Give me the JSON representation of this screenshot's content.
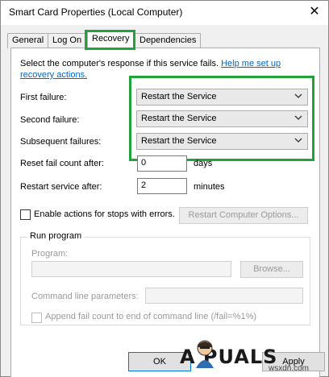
{
  "window": {
    "title": "Smart Card Properties (Local Computer)",
    "close_glyph": "✕"
  },
  "tabs": [
    {
      "label": "General"
    },
    {
      "label": "Log On"
    },
    {
      "label": "Recovery"
    },
    {
      "label": "Dependencies"
    }
  ],
  "recovery": {
    "description": "Select the computer's response if this service fails.",
    "help_link": "Help me set up recovery actions.",
    "first_failure": {
      "label": "First failure:",
      "value": "Restart the Service"
    },
    "second_failure": {
      "label": "Second failure:",
      "value": "Restart the Service"
    },
    "subsequent_failures": {
      "label": "Subsequent failures:",
      "value": "Restart the Service"
    },
    "reset_fail_count": {
      "label": "Reset fail count after:",
      "value": "0",
      "unit": "days"
    },
    "restart_service": {
      "label": "Restart service after:",
      "value": "2",
      "unit": "minutes"
    },
    "enable_actions": {
      "label": "Enable actions for stops with errors.",
      "checked": false
    },
    "restart_computer_options": "Restart Computer Options...",
    "run_program": {
      "legend": "Run program",
      "program_label": "Program:",
      "program_value": "",
      "browse_label": "Browse...",
      "cmd_label": "Command line parameters:",
      "cmd_value": "",
      "append_label": "Append fail count to end of command line (/fail=%1%)"
    }
  },
  "buttons": {
    "ok": "OK",
    "apply": "Apply"
  },
  "watermark": {
    "brand": "A  PUALS",
    "site": "wsxdn.com"
  },
  "colors": {
    "highlight": "#22a33a",
    "link": "#0066cc"
  }
}
